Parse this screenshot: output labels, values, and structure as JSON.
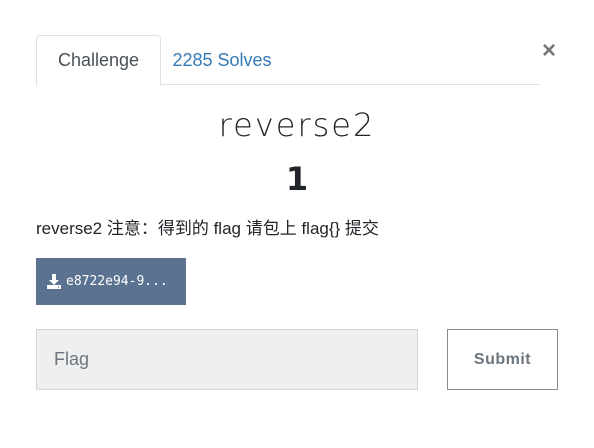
{
  "tabs": [
    {
      "label": "Challenge",
      "active": true
    },
    {
      "label": "2285 Solves",
      "active": false
    }
  ],
  "close_glyph": "×",
  "challenge": {
    "name": "reverse2",
    "value": "1",
    "description": "reverse2 注意：得到的 flag 请包上 flag{} 提交"
  },
  "file": {
    "icon": "download-icon",
    "label": "e8722e94-9..."
  },
  "flag_input": {
    "placeholder": "Flag",
    "value": ""
  },
  "submit_label": "Submit",
  "colors": {
    "file_button_bg": "#5b7290",
    "link_blue": "#337ab7",
    "input_bg": "#efefef"
  }
}
